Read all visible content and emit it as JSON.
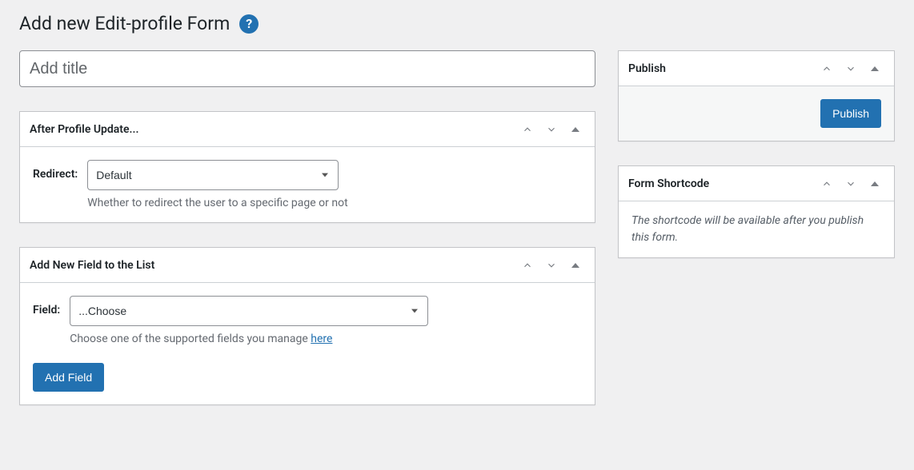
{
  "page": {
    "title": "Add new Edit-profile Form"
  },
  "titleField": {
    "placeholder": "Add title",
    "value": ""
  },
  "afterProfileUpdate": {
    "title": "After Profile Update...",
    "redirectLabel": "Redirect:",
    "redirectSelected": "Default",
    "redirectDescription": "Whether to redirect the user to a specific page or not"
  },
  "addNewField": {
    "title": "Add New Field to the List",
    "fieldLabel": "Field:",
    "fieldSelected": "...Choose",
    "descriptionPrefix": "Choose one of the supported fields you manage ",
    "hereLink": "here",
    "addFieldButton": "Add Field"
  },
  "publishBox": {
    "title": "Publish",
    "publishButton": "Publish"
  },
  "shortcodeBox": {
    "title": "Form Shortcode",
    "note": "The shortcode will be available after you publish this form."
  }
}
